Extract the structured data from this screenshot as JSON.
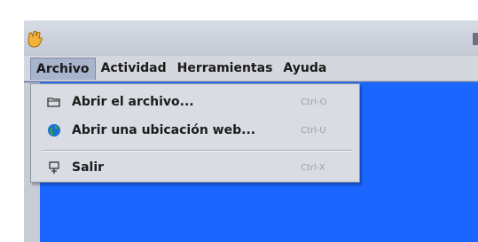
{
  "menubar": {
    "items": [
      {
        "label": "Archivo",
        "active": true
      },
      {
        "label": "Actividad",
        "active": false
      },
      {
        "label": "Herramientas",
        "active": false
      },
      {
        "label": "Ayuda",
        "active": false
      }
    ]
  },
  "dropdown": {
    "items": [
      {
        "icon": "folder-open-icon",
        "label": "Abrir el archivo...",
        "shortcut": "Ctrl-O"
      },
      {
        "icon": "globe-icon",
        "label": "Abrir una ubicación web...",
        "shortcut": "Ctrl-U"
      },
      {
        "icon": "exit-icon",
        "label": "Salir",
        "shortcut": "Ctrl-X"
      }
    ]
  },
  "colors": {
    "desktop": "#ffffff",
    "content": "#1a66ff",
    "menu_bg": "#d4d7de",
    "active_menu": "#a8b3cc",
    "dropdown_bg": "#d9dce3",
    "shortcut_text": "#9aa0ab"
  }
}
